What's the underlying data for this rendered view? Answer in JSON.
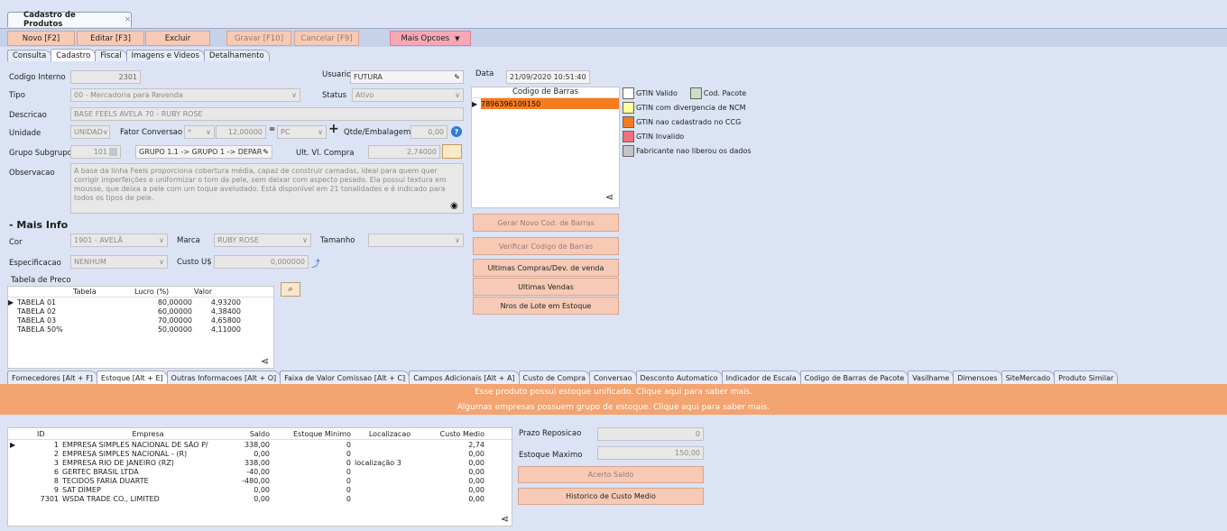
{
  "window": {
    "tab_title": "Cadastro de Produtos",
    "close": "×"
  },
  "toolbar": {
    "new": "Novo [F2]",
    "edit": "Editar [F3]",
    "delete": "Excluir",
    "save": "Gravar [F10]",
    "cancel": "Cancelar [F9]",
    "more": "Mais Opcoes"
  },
  "top_tabs": [
    "Consulta",
    "Cadastro",
    "Fiscal",
    "Imagens e Videos",
    "Detalhamento"
  ],
  "form": {
    "codigo_interno_label": "Codigo Interno",
    "codigo_interno": "2301",
    "usuario_label": "Usuario",
    "usuario": "FUTURA",
    "data_label": "Data",
    "data": "21/09/2020 10:51:40",
    "tipo_label": "Tipo",
    "tipo": "00 - Mercadoria para Revenda",
    "status_label": "Status",
    "status": "Ativo",
    "descricao_label": "Descricao",
    "descricao": "BASE FEELS AVELA 70 - RUBY ROSE",
    "unidade_label": "Unidade",
    "unidade": "UNIDAD",
    "fator_label": "Fator Conversao",
    "fator_op": "*",
    "fator": "12,00000",
    "fator_eq": "=",
    "fator_unit": "PC",
    "plus": "+",
    "qtde_label": "Qtde/Embalagem",
    "qtde": "0,00",
    "grupo_label": "Grupo Subgrupo",
    "grupo_code": "101",
    "grupo": "GRUPO 1.1 -> GRUPO 1 -> DEPAR",
    "ult_label": "Ult. Vl. Compra",
    "ult": "2,74000",
    "obs_label": "Observacao",
    "obs": "A base da linha Feels proporciona cobertura média, capaz de construir camadas, ideal para quem quer corrigir imperfeições e uniformizar o tom da pele, sem deixar com aspecto pesado. Ela possui textura em mousse, que deixa a pele com um toque aveludado. Está disponível em 21 tonalidades e é indicado para todos os tipos de pele.",
    "mais_info": "- Mais Info",
    "cor_label": "Cor",
    "cor": "1901 - AVELÃ",
    "marca_label": "Marca",
    "marca": "RUBY ROSE",
    "tamanho_label": "Tamanho",
    "tamanho": "",
    "espec_label": "Especificacao",
    "espec": "NENHUM",
    "custo_label": "Custo U$",
    "custo": "0,000000",
    "tabela_preco_label": "Tabela de Preco"
  },
  "price_table": {
    "headers": [
      "Tabela",
      "Lucro (%)",
      "Valor"
    ],
    "rows": [
      [
        "TABELA 01",
        "80,00000",
        "4,93200"
      ],
      [
        "TABELA 02",
        "60,00000",
        "4,38400"
      ],
      [
        "TABELA 03",
        "70,00000",
        "4,65800"
      ],
      [
        "TABELA 50%",
        "50,00000",
        "4,11000"
      ]
    ]
  },
  "barcodes": {
    "header": "Codigo de Barras",
    "rows": [
      "7896396109150"
    ]
  },
  "barcode_buttons": {
    "new": "Gerar Novo Cod. de Barras",
    "verify": "Verificar Codigo de Barras",
    "last_purchases": "Ultimas Compras/Dev. de venda",
    "last_sales": "Ultimas Vendas",
    "lots": "Nros de Lote em Estoque"
  },
  "legend": [
    {
      "label": "GTIN Valido",
      "color": "#ffffff"
    },
    {
      "label": "Cod. Pacote",
      "color": "#c9e1c2"
    },
    {
      "label": "GTIN com divergencia de NCM",
      "color": "#ffff99"
    },
    {
      "label": "GTIN nao cadastrado no CCG",
      "color": "#f47c20"
    },
    {
      "label": "GTIN Invalido",
      "color": "#f0707c"
    },
    {
      "label": "Fabricante nao liberou os dados",
      "color": "#c4c4c4"
    }
  ],
  "bottom_tabs": [
    "Fornecedores [Alt + F]",
    "Estoque [Alt + E]",
    "Outras Informacoes [Alt + O]",
    "Faixa de Valor Comissao [Alt + C]",
    "Campos Adicionais [Alt + A]",
    "Custo de Compra",
    "Conversao",
    "Desconto Automatico",
    "Indicador de Escala",
    "Codigo de Barras de Pacote",
    "Vasilhame",
    "Dimensoes",
    "SiteMercado",
    "Produto Similar"
  ],
  "banner": {
    "line1": "Esse produto possui estoque unificado. Clique aqui para saber mais.",
    "line2": "Algumas empresas possuem grupo de estoque. Clique aqui para saber mais."
  },
  "stock_table": {
    "headers": [
      "ID",
      "Empresa",
      "Saldo",
      "Estoque Minimo",
      "Localizacao",
      "Custo Medio"
    ],
    "rows": [
      [
        "1",
        "EMPRESA SIMPLES NACIONAL DE SÃO P/",
        "338,00",
        "0",
        "",
        "2,74"
      ],
      [
        "2",
        "EMPRESA SIMPLES NACIONAL -  (R)",
        "0,00",
        "0",
        "",
        "0,00"
      ],
      [
        "3",
        "EMPRESA RIO DE JANEIRO (RZ)",
        "338,00",
        "0",
        "localização 3",
        "0,00"
      ],
      [
        "6",
        "GERTEC BRASIL LTDA",
        "-40,00",
        "0",
        "",
        "0,00"
      ],
      [
        "8",
        "TECIDOS FARIA DUARTE",
        "-480,00",
        "0",
        "",
        "0,00"
      ],
      [
        "9",
        "SAT DIMEP",
        "0,00",
        "0",
        "",
        "0,00"
      ],
      [
        "7301",
        "WSDA TRADE CO., LIMITED",
        "0,00",
        "0",
        "",
        "0,00"
      ]
    ]
  },
  "stock_side": {
    "prazo_label": "Prazo Reposicao",
    "prazo": "0",
    "max_label": "Estoque Maximo",
    "max": "150,00",
    "acerto": "Acerto Saldo",
    "historico": "Historico de Custo Medio"
  }
}
